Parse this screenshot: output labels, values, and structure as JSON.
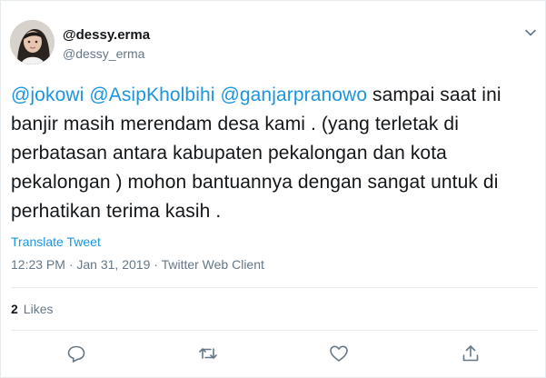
{
  "user": {
    "display_name": "@dessy.erma",
    "handle": "@dessy_erma",
    "avatar_icon": "profile-photo"
  },
  "tweet": {
    "mentions": [
      "@jokowi",
      "@AsipKholbihi",
      "@ganjarpranowo"
    ],
    "text": " sampai saat ini banjir masih merendam desa kami . (yang terletak di perbatasan antara kabupaten pekalongan dan kota pekalongan )  mohon bantuannya dengan sangat untuk di perhatikan terima kasih ."
  },
  "translate_label": "Translate Tweet",
  "meta": {
    "time": "12:23 PM",
    "separator1": " · ",
    "date": "Jan 31, 2019",
    "separator2": " · ",
    "client": "Twitter Web Client"
  },
  "stats": {
    "likes_count": "2",
    "likes_label": "Likes"
  },
  "actions": {
    "reply_icon": "reply-icon",
    "retweet_icon": "retweet-icon",
    "like_icon": "heart-icon",
    "share_icon": "share-icon"
  },
  "colors": {
    "accent": "#1b95e0",
    "muted": "#657786",
    "text": "#14171a",
    "border": "#e6ecf0"
  }
}
